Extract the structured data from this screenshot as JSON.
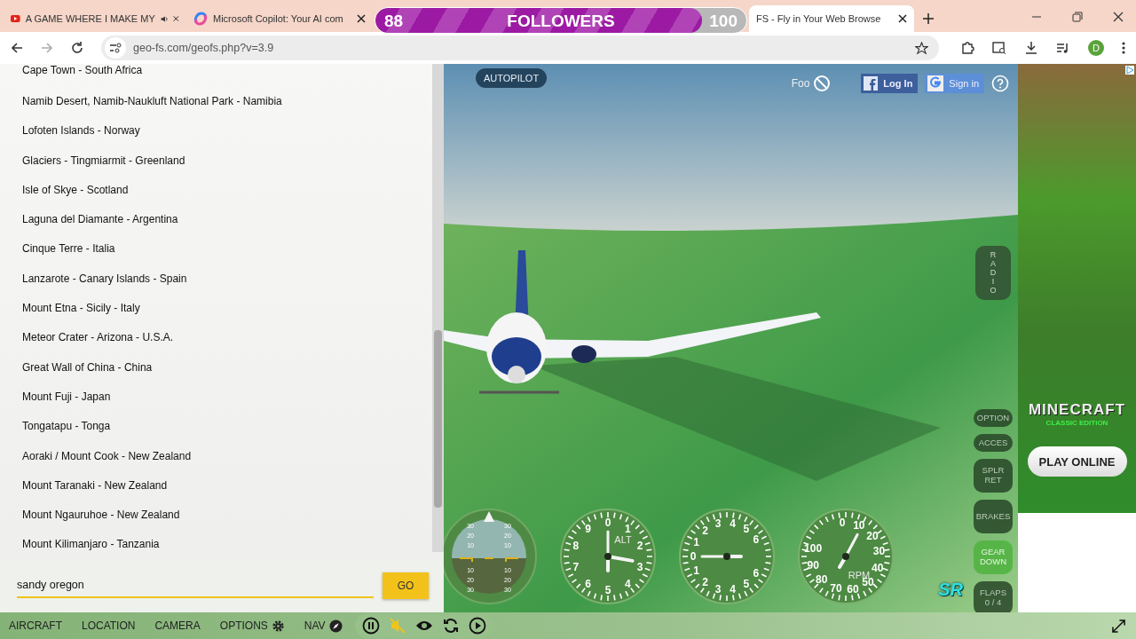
{
  "browser": {
    "tabs": [
      {
        "title": "A GAME WHERE I MAKE MY",
        "kind": "video",
        "audio": true,
        "selected": false
      },
      {
        "title": "Microsoft Copilot: Your AI com",
        "kind": "copilot",
        "audio": false,
        "selected": false
      },
      {
        "title": "FS - Fly in Your Web Browse",
        "kind": "plain",
        "audio": false,
        "selected": true
      }
    ],
    "url": "geo-fs.com/geofs.php?v=3.9",
    "profile_initial": "D"
  },
  "followers_goal": {
    "current": "88",
    "label": "FOLLOWERS",
    "target": "100",
    "level": 0.88
  },
  "locations": [
    "Cape Town - South Africa",
    "Namib Desert, Namib-Naukluft National Park - Namibia",
    "Lofoten Islands - Norway",
    "Glaciers - Tingmiarmit - Greenland",
    "Isle of Skye - Scotland",
    "Laguna del Diamante - Argentina",
    "Cinque Terre - Italia",
    "Lanzarote - Canary Islands - Spain",
    "Mount Etna - Sicily - Italy",
    "Meteor Crater - Arizona - U.S.A.",
    "Great Wall of China - China",
    "Mount Fuji - Japan",
    "Tongatapu - Tonga",
    "Aoraki / Mount Cook - New Zealand",
    "Mount Taranaki - New Zealand",
    "Mount Ngauruhoe - New Zealand",
    "Mount Kilimanjaro - Tanzania"
  ],
  "search": {
    "value": "sandy oregon",
    "button": "GO"
  },
  "scene": {
    "autopilot": "AUTOPILOT",
    "foo": "Foo",
    "facebook": "Log In",
    "google": "Sign in",
    "logo": "SR",
    "radio": {
      "label": "RADIO",
      "active": false
    },
    "side_controls": [
      {
        "lines": [
          "OPTION"
        ],
        "kind": "short",
        "active": false
      },
      {
        "lines": [
          "ACCES"
        ],
        "kind": "short",
        "active": false
      },
      {
        "lines": [
          "SPLR",
          "RET"
        ],
        "kind": "tall",
        "active": false
      },
      {
        "lines": [
          "BRAKES"
        ],
        "kind": "tall",
        "active": false
      },
      {
        "lines": [
          "GEAR",
          "DOWN"
        ],
        "kind": "tall",
        "active": true
      },
      {
        "lines": [
          "FLAPS",
          "0 / 4"
        ],
        "kind": "tall",
        "active": false
      }
    ],
    "gauges": [
      {
        "kind": "attitude",
        "left_labels": [
          "30",
          "20",
          "10",
          "10",
          "20",
          "30"
        ],
        "right_labels": [
          "30",
          "20",
          "10",
          "10",
          "20",
          "30"
        ]
      },
      {
        "kind": "altimeter",
        "labels": [
          "0",
          "1",
          "2",
          "3",
          "4",
          "5",
          "6",
          "7",
          "8",
          "9"
        ],
        "caption": "ALT"
      },
      {
        "kind": "vsi",
        "labels": [
          "0",
          "1",
          "2",
          "3",
          "4",
          "5",
          "6",
          "1",
          "2",
          "3",
          "4",
          "5",
          "6"
        ]
      },
      {
        "kind": "rpm",
        "labels": [
          "0",
          "10",
          "20",
          "30",
          "40",
          "50",
          "60",
          "70",
          "80",
          "90",
          "100"
        ],
        "caption": "RPM"
      }
    ]
  },
  "ad": {
    "logo": "MINECRAFT",
    "subtitle": "CLASSIC EDITION",
    "button": "PLAY ONLINE"
  },
  "menu": [
    {
      "label": "AIRCRAFT",
      "kind": "text"
    },
    {
      "label": "LOCATION",
      "kind": "text"
    },
    {
      "label": "CAMERA",
      "kind": "text"
    },
    {
      "label": "OPTIONS",
      "kind": "gear"
    },
    {
      "label": "NAV",
      "kind": "compass"
    }
  ],
  "controls": [
    {
      "kind": "pause",
      "active": false
    },
    {
      "kind": "mute",
      "active": true
    },
    {
      "kind": "eye",
      "active": false
    },
    {
      "kind": "refresh",
      "active": false
    },
    {
      "kind": "play",
      "active": false
    }
  ]
}
